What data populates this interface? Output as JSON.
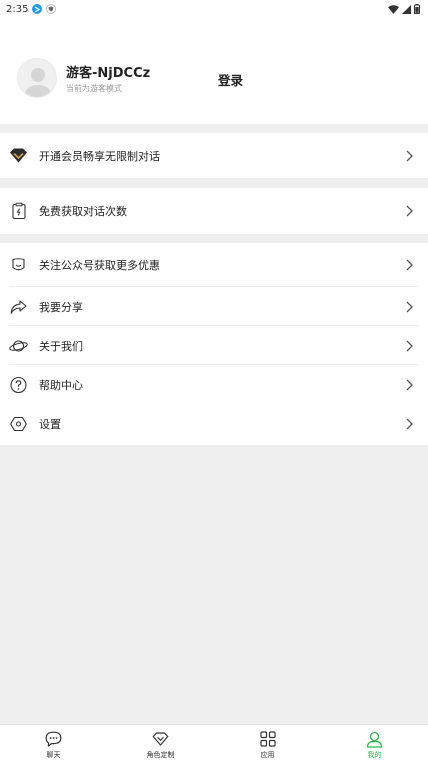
{
  "status_bar": {
    "time": "2:35"
  },
  "profile": {
    "username": "游客-NjDCCz",
    "subtitle": "当前为游客模式",
    "login_label": "登录"
  },
  "menu": {
    "vip": "开通会员畅享无限制对话",
    "free_chats": "免费获取对话次数",
    "follow_official": "关注公众号获取更多优惠",
    "share": "我要分享",
    "about": "关于我们",
    "help": "帮助中心",
    "settings": "设置"
  },
  "tabbar": {
    "tabs": [
      {
        "label": "聊天",
        "icon": "chat-bubble-icon"
      },
      {
        "label": "角色定制",
        "icon": "diamond-icon"
      },
      {
        "label": "应用",
        "icon": "apps-grid-icon"
      },
      {
        "label": "我的",
        "icon": "person-icon"
      }
    ],
    "active_index": 3
  },
  "colors": {
    "accent": "#2fb84f",
    "page_bg": "#efefef",
    "vip_gold": "#c9a24a"
  }
}
